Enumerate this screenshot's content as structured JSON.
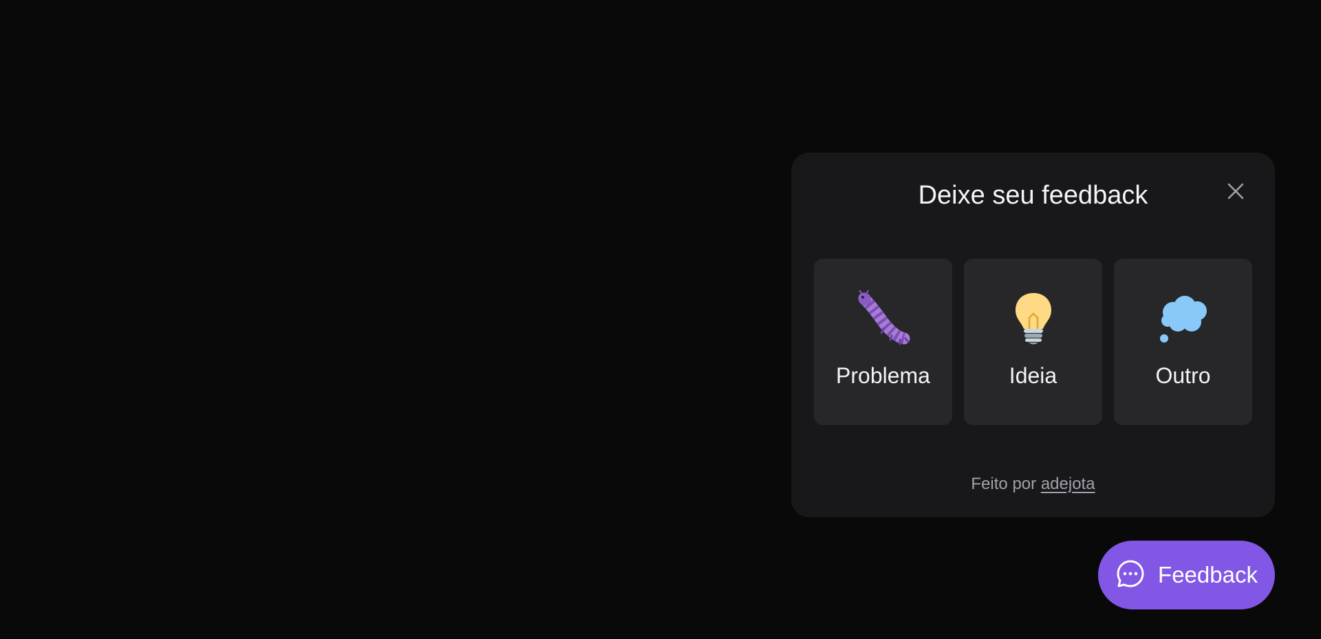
{
  "colors": {
    "background": "#09090a",
    "panel": "#18181b",
    "card": "#27272a",
    "brand": "#8257e5",
    "text": "#f4f4f5",
    "muted": "#a1a1aa"
  },
  "widget": {
    "title": "Deixe seu feedback",
    "close_icon": "close-icon",
    "options": [
      {
        "label": "Problema",
        "icon": "bug-icon"
      },
      {
        "label": "Ideia",
        "icon": "lightbulb-icon"
      },
      {
        "label": "Outro",
        "icon": "thought-bubble-icon"
      }
    ],
    "footer": {
      "prefix": "Feito por",
      "link": "adejota"
    }
  },
  "feedback_button": {
    "label": "Feedback",
    "icon": "chat-bubble-icon"
  }
}
